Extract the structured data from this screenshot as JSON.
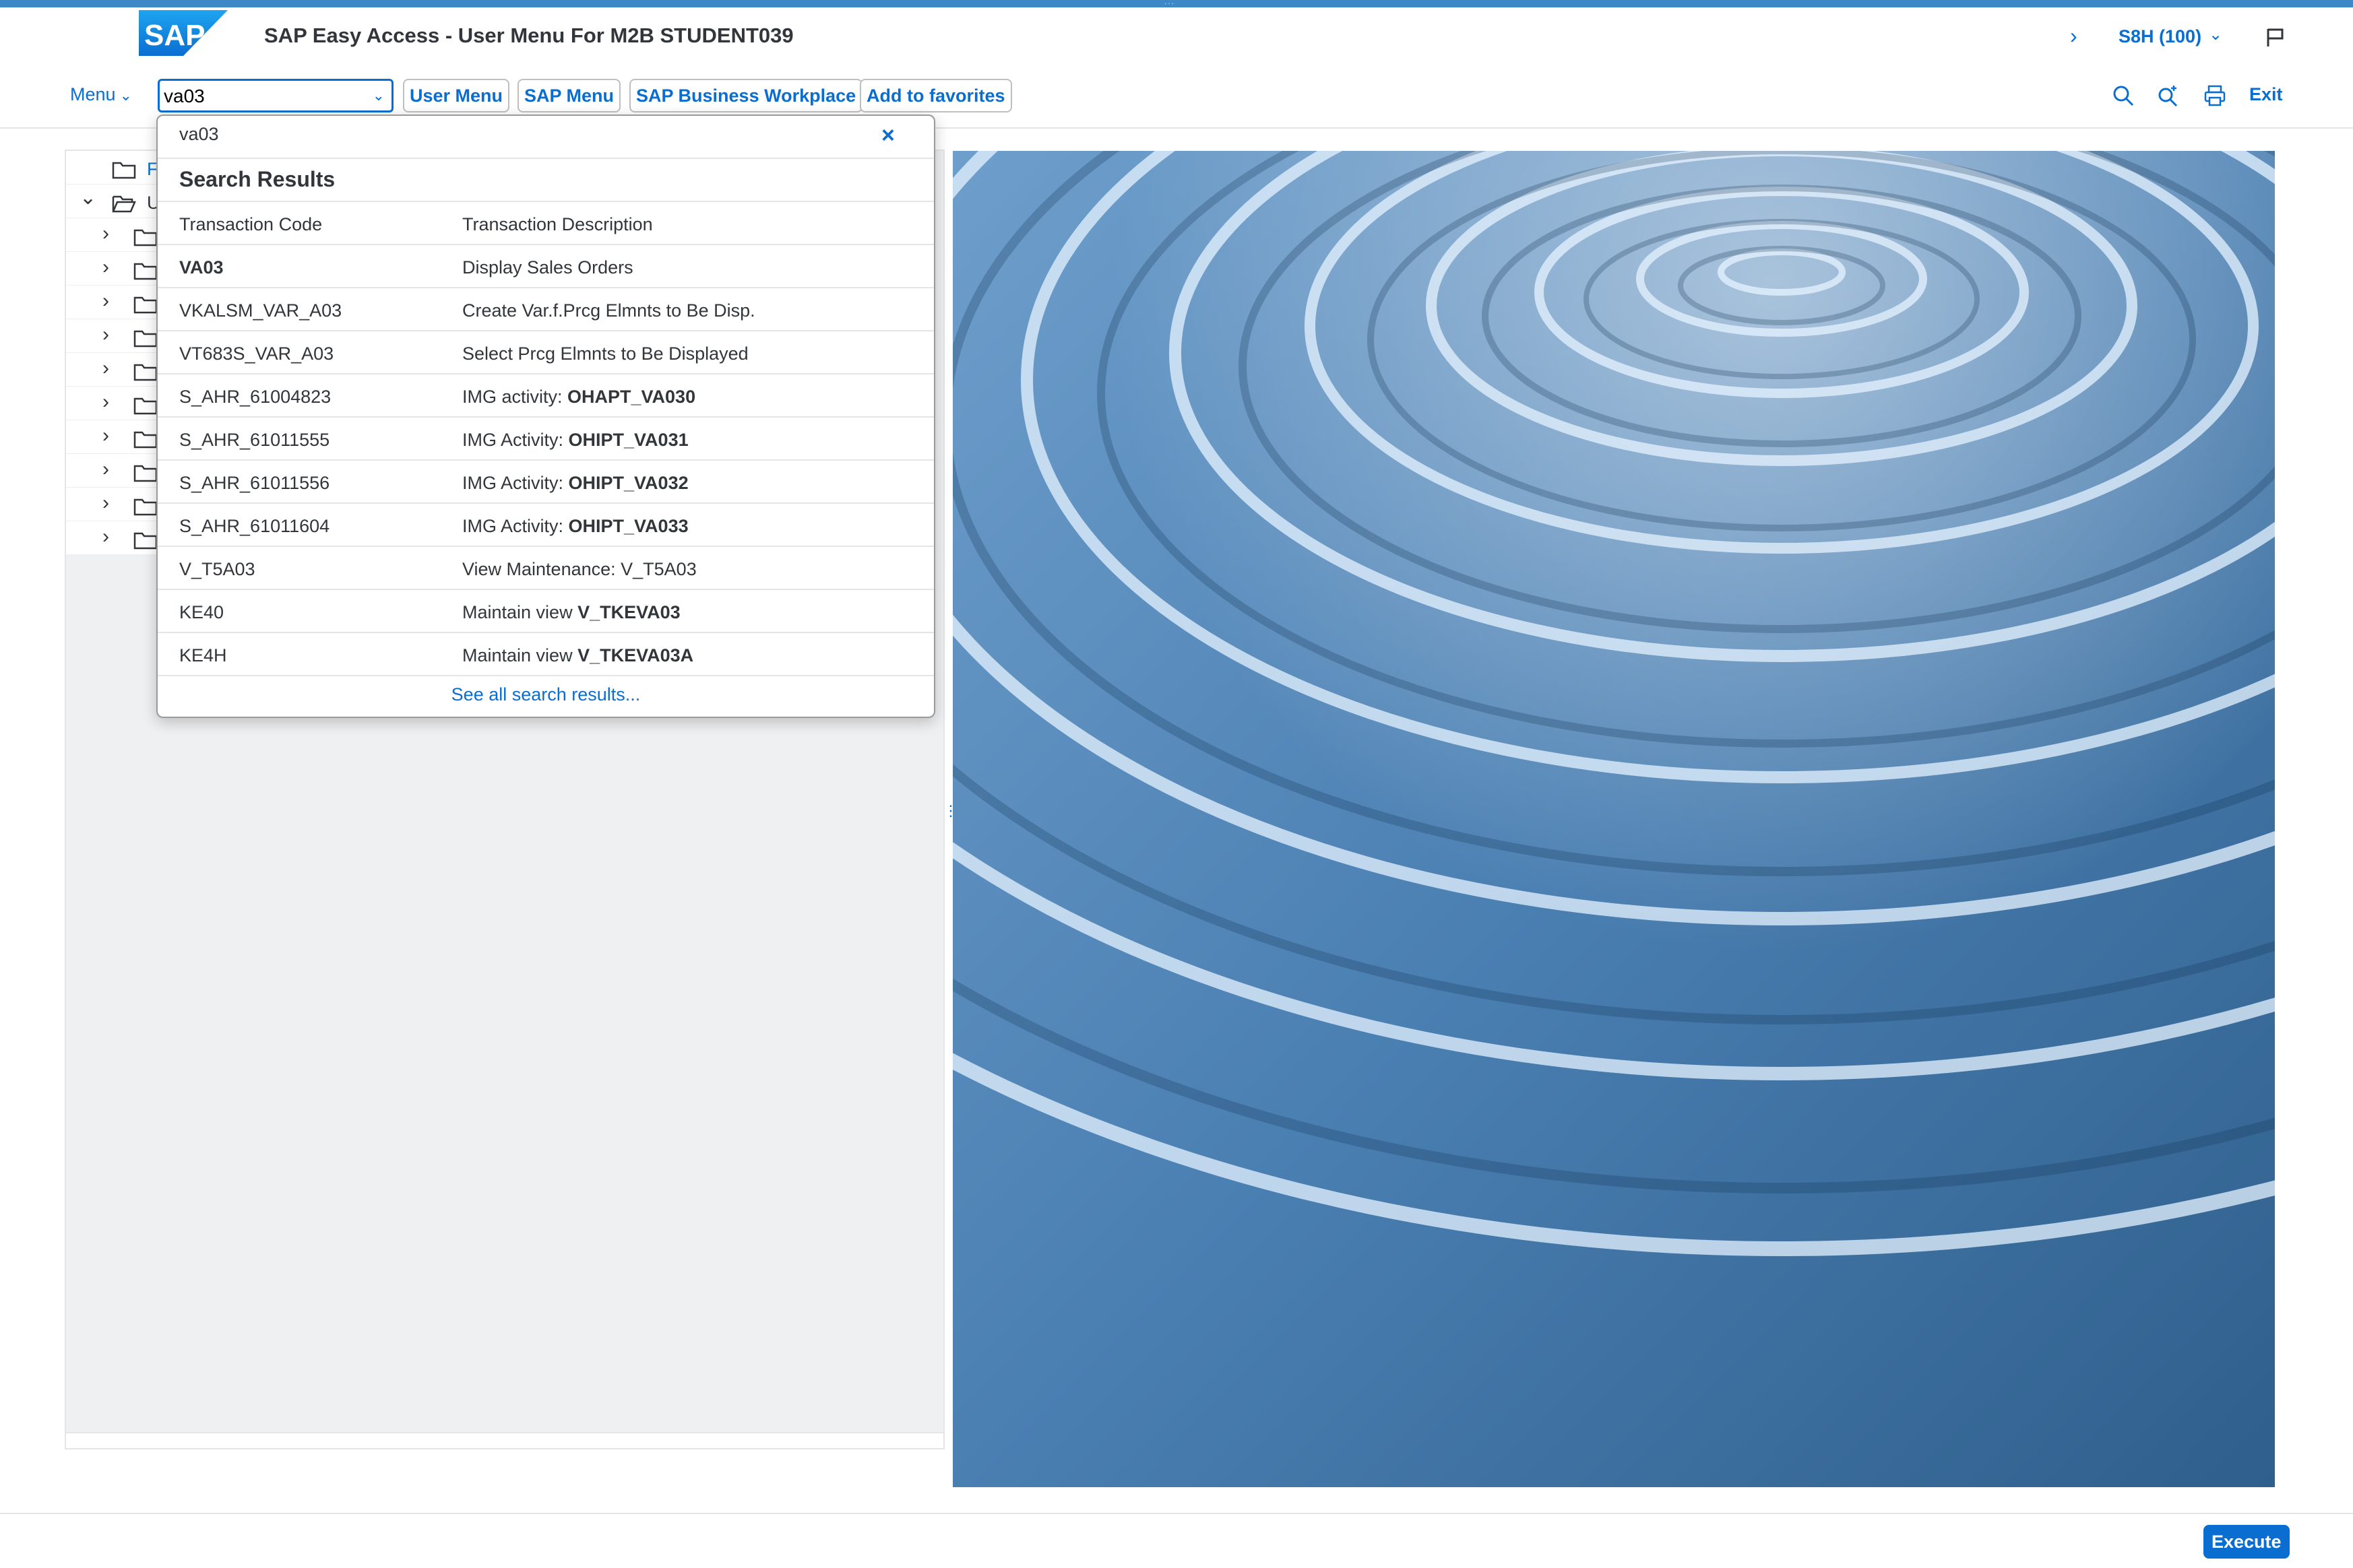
{
  "shell": {
    "logo_text": "SAP",
    "title": "SAP Easy Access  -  User Menu For M2B STUDENT039",
    "system": "S8H (100)"
  },
  "toolbar": {
    "menu_label": "Menu",
    "command_value": "va03",
    "buttons": [
      "User Menu",
      "SAP Menu",
      "SAP Business Workplace",
      "Add to favorites"
    ],
    "exit_label": "Exit"
  },
  "tree": {
    "favorites_label": "F",
    "user_menu_label": "U"
  },
  "search_popup": {
    "query": "va03",
    "heading": "Search Results",
    "col_code": "Transaction Code",
    "col_desc": "Transaction Description",
    "results": [
      {
        "code": "VA03",
        "desc_prefix": "Display Sales Orders",
        "desc_bold": ""
      },
      {
        "code": "VKALSM_VAR_A03",
        "desc_prefix": "Create Var.f.Prcg Elmnts to Be Disp.",
        "desc_bold": ""
      },
      {
        "code": "VT683S_VAR_A03",
        "desc_prefix": "Select Prcg Elmnts to Be Displayed",
        "desc_bold": ""
      },
      {
        "code": "S_AHR_61004823",
        "desc_prefix": "IMG activity: ",
        "desc_bold": "OHAPT_VA030"
      },
      {
        "code": "S_AHR_61011555",
        "desc_prefix": "IMG Activity: ",
        "desc_bold": "OHIPT_VA031"
      },
      {
        "code": "S_AHR_61011556",
        "desc_prefix": "IMG Activity: ",
        "desc_bold": "OHIPT_VA032"
      },
      {
        "code": "S_AHR_61011604",
        "desc_prefix": "IMG Activity: ",
        "desc_bold": "OHIPT_VA033"
      },
      {
        "code": "V_T5A03",
        "desc_prefix": "View Maintenance: V_T5A03",
        "desc_bold": ""
      },
      {
        "code": "KE40",
        "desc_prefix": "Maintain view ",
        "desc_bold": "V_TKEVA03"
      },
      {
        "code": "KE4H",
        "desc_prefix": "Maintain view ",
        "desc_bold": "V_TKEVA03A"
      }
    ],
    "see_all": "See all search results..."
  },
  "footer": {
    "execute_label": "Execute"
  },
  "colors": {
    "brand_blue": "#0a6ed1",
    "top_strip": "#3e88c8",
    "pane_bg": "#eef0f2"
  }
}
